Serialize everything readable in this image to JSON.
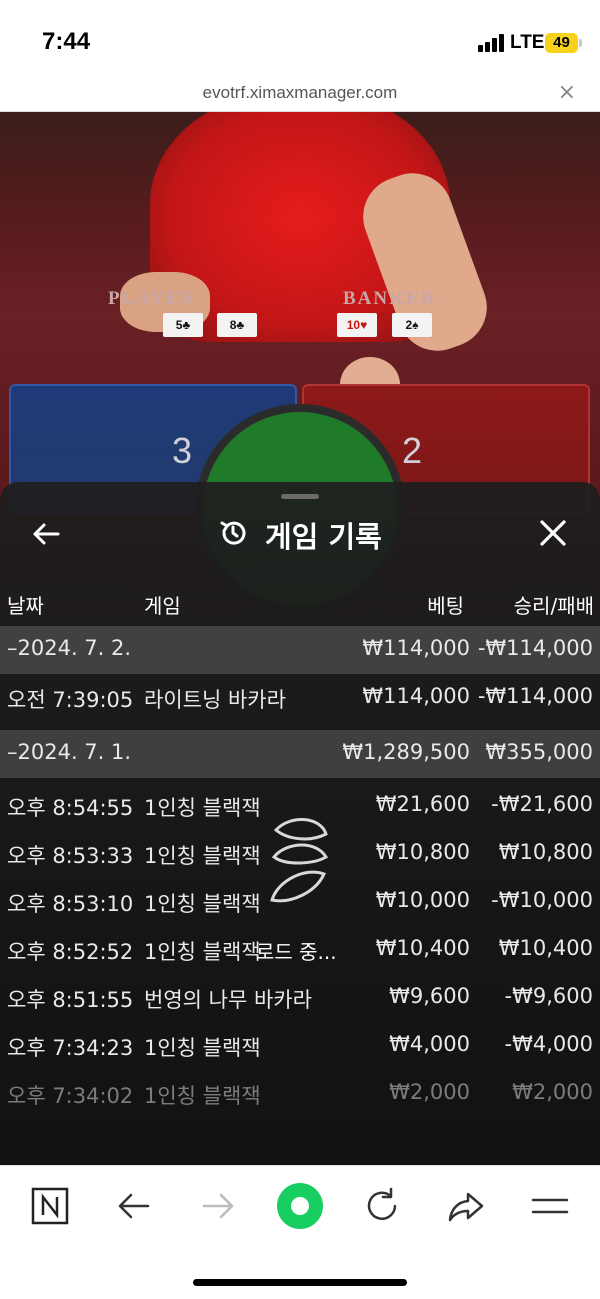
{
  "status_bar": {
    "time": "7:44",
    "network": "LTE",
    "battery": "49",
    "battery_color": "#f7d21b"
  },
  "browser": {
    "url": "evotrf.ximaxmanager.com",
    "close_icon": "close-icon"
  },
  "game_table": {
    "player_label": "PLAYER",
    "banker_label": "BANKER",
    "player_cards": [
      "5♣",
      "8♣"
    ],
    "banker_cards": [
      "10♥",
      "2♠"
    ],
    "player_score": "3",
    "banker_score": "2",
    "player_color": "#223a6c",
    "banker_color": "#7a1717",
    "tie_color": "#1f7b2a"
  },
  "panel": {
    "title": "게임 기록",
    "back_icon": "back-arrow-icon",
    "history_icon": "history-icon",
    "close_icon": "close-icon",
    "columns": {
      "date": "날짜",
      "game": "게임",
      "bet": "베팅",
      "win_loss": "승리/패배"
    },
    "rows": [
      {
        "type": "group",
        "time": "–2024. 7. 2.",
        "game": "",
        "bet": "₩114,000",
        "result": "-₩114,000"
      },
      {
        "type": "item",
        "time": "오전 7:39:05",
        "game": "라이트닝 바카라",
        "bet": "₩114,000",
        "result": "-₩114,000"
      },
      {
        "type": "group",
        "time": "–2024. 7. 1.",
        "game": "",
        "bet": "₩1,289,500",
        "result": "₩355,000"
      },
      {
        "type": "item",
        "time": "오후 8:54:55",
        "game": "1인칭 블랙잭",
        "bet": "₩21,600",
        "result": "-₩21,600"
      },
      {
        "type": "item",
        "time": "오후 8:53:33",
        "game": "1인칭 블랙잭",
        "bet": "₩10,800",
        "result": "₩10,800"
      },
      {
        "type": "item",
        "time": "오후 8:53:10",
        "game": "1인칭 블랙잭",
        "bet": "₩10,000",
        "result": "-₩10,000"
      },
      {
        "type": "item",
        "time": "오후 8:52:52",
        "game": "1인칭 블랙잭",
        "bet": "₩10,400",
        "result": "₩10,400"
      },
      {
        "type": "item",
        "time": "오후 8:51:55",
        "game": "번영의 나무 바카라",
        "bet": "₩9,600",
        "result": "-₩9,600"
      },
      {
        "type": "item",
        "time": "오후 7:34:23",
        "game": "1인칭 블랙잭",
        "bet": "₩4,000",
        "result": "-₩4,000"
      },
      {
        "type": "item",
        "time": "오후 7:34:02",
        "game": "1인칭 블랙잭",
        "bet": "₩2,000",
        "result": "₩2,000"
      }
    ],
    "loading_text": "로드 중..."
  },
  "toolbar": {
    "items": [
      "naver-n-icon",
      "back-arrow-icon",
      "forward-arrow-icon",
      "green-dot-icon",
      "reload-icon",
      "share-icon",
      "menu-icon"
    ],
    "accent": "#19ce60"
  }
}
